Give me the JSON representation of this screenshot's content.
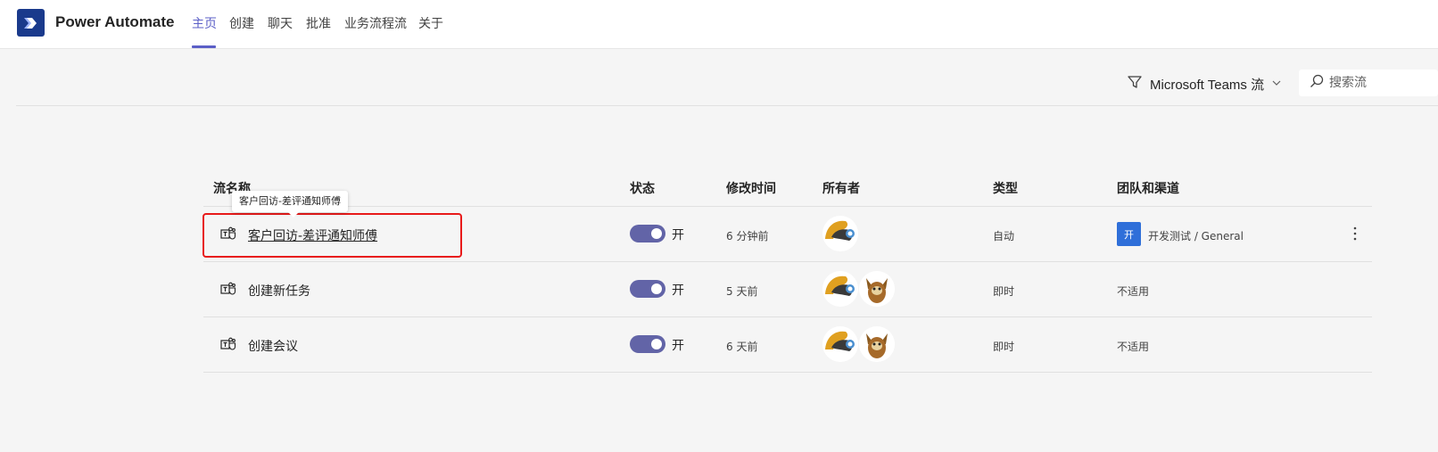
{
  "app": {
    "title": "Power Automate"
  },
  "nav": {
    "tabs": [
      {
        "label": "主页",
        "active": true
      },
      {
        "label": "创建"
      },
      {
        "label": "聊天"
      },
      {
        "label": "批准"
      },
      {
        "label": "业务流程流"
      },
      {
        "label": "关于"
      }
    ]
  },
  "toolbar": {
    "filter_label": "Microsoft Teams 流",
    "search_placeholder": "搜索流"
  },
  "table": {
    "headers": {
      "name": "流名称",
      "status": "状态",
      "modified": "修改时间",
      "owners": "所有者",
      "type": "类型",
      "team_channel": "团队和渠道"
    },
    "rows": [
      {
        "name": "客户回访-差评通知师傅",
        "status": "开",
        "modified": "6 分钟前",
        "type": "自动",
        "team_badge": "开",
        "team_channel": "开发测试 / General"
      },
      {
        "name": "创建新任务",
        "status": "开",
        "modified": "5 天前",
        "type": "即时",
        "team_channel": "不适用"
      },
      {
        "name": "创建会议",
        "status": "开",
        "modified": "6 天前",
        "type": "即时",
        "team_channel": "不适用"
      }
    ]
  },
  "tooltip": {
    "text": "客户回访-差评通知师傅"
  },
  "colors": {
    "accent": "#5b5fc7",
    "toggle": "#6264a7",
    "highlight": "#e81a1a",
    "team_badge": "#2f6fd9"
  },
  "icons": [
    "power-automate-logo",
    "filter-icon",
    "chevron-down-icon",
    "search-icon",
    "teams-icon",
    "more-options-icon"
  ]
}
